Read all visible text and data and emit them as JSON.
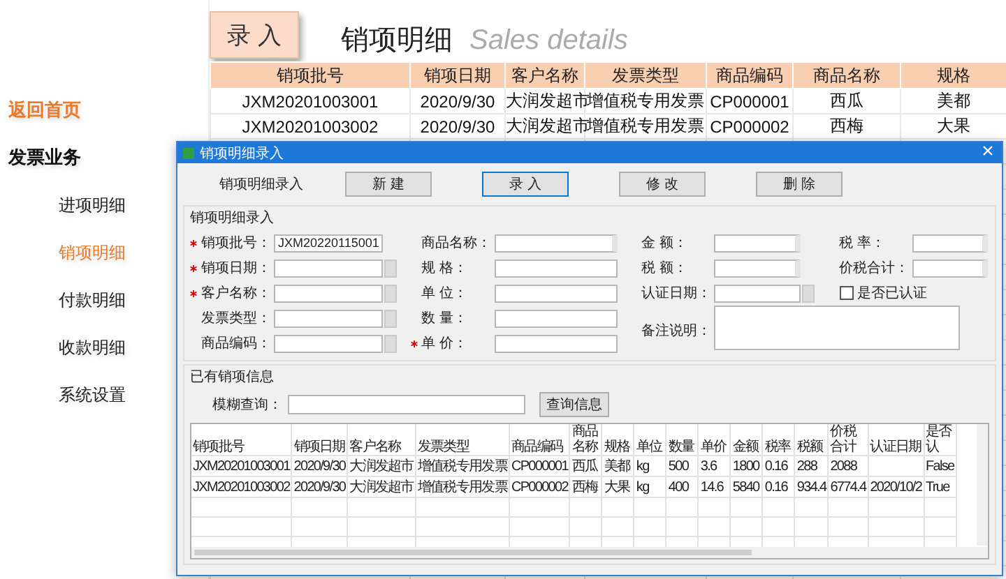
{
  "header_button": {
    "label": "录 入"
  },
  "page_title": "销项明细",
  "page_subtitle": "Sales details",
  "sidebar": {
    "items": [
      {
        "label": "返回首页",
        "kind": "link"
      },
      {
        "label": "发票业务",
        "kind": "heading"
      },
      {
        "label": "进项明细",
        "kind": "item",
        "selected": false
      },
      {
        "label": "销项明细",
        "kind": "item",
        "selected": true
      },
      {
        "label": "付款明细",
        "kind": "item",
        "selected": false
      },
      {
        "label": "收款明细",
        "kind": "item",
        "selected": false
      },
      {
        "label": "系统设置",
        "kind": "item",
        "selected": false
      }
    ]
  },
  "sheet": {
    "columns": [
      "销项批号",
      "销项日期",
      "客户名称",
      "发票类型",
      "商品编码",
      "商品名称",
      "规格"
    ],
    "rows": [
      [
        "JXM20201003001",
        "2020/9/30",
        "大润发超市",
        "增值税专用发票",
        "CP000001",
        "西瓜",
        "美都"
      ],
      [
        "JXM20201003002",
        "2020/9/30",
        "大润发超市",
        "增值税专用发票",
        "CP000002",
        "西梅",
        "大果"
      ]
    ]
  },
  "dialog": {
    "title": "销项明细录入",
    "heading": "销项明细录入",
    "buttons": [
      "新 建",
      "录 入",
      "修 改",
      "删 除"
    ],
    "entry_group": {
      "title": "销项明细录入",
      "columns": [
        [
          {
            "label": "销项批号：",
            "kind": "text",
            "required": true,
            "value": "JXM20220115001"
          },
          {
            "label": "销项日期：",
            "kind": "select",
            "required": true
          },
          {
            "label": "客户名称：",
            "kind": "select",
            "required": true
          },
          {
            "label": "发票类型：",
            "kind": "select",
            "required": false
          },
          {
            "label": "商品编码：",
            "kind": "select",
            "required": false
          }
        ],
        [
          {
            "label": "商品名称：",
            "kind": "spin",
            "required": false
          },
          {
            "label": "规 格：",
            "kind": "text",
            "required": false
          },
          {
            "label": "单 位：",
            "kind": "text",
            "required": false
          },
          {
            "label": "数 量：",
            "kind": "text",
            "required": false
          },
          {
            "label": "单 价：",
            "kind": "text",
            "required": true
          }
        ],
        [
          {
            "label": "金 额：",
            "kind": "spin",
            "required": false
          },
          {
            "label": "税 额：",
            "kind": "spin",
            "required": false
          },
          {
            "label": "认证日期：",
            "kind": "select",
            "required": false
          },
          {
            "label": "备注说明：",
            "kind": "memo",
            "required": false
          }
        ],
        [
          {
            "label": "税 率：",
            "kind": "spin",
            "required": false
          },
          {
            "label": "价税合计：",
            "kind": "spin",
            "required": false
          },
          {
            "label": "是否已认证",
            "kind": "checkbox",
            "checked": false,
            "required": false
          }
        ]
      ]
    },
    "search_group": {
      "title": "已有销项信息",
      "search_label": "模糊查询：",
      "search_button": "查询信息",
      "table": {
        "columns": [
          "销项批号",
          "销项日期",
          "客户名称",
          "发票类型",
          "商品编码",
          "商品名称",
          "规格",
          "单位",
          "数量",
          "单价",
          "金额",
          "税率",
          "税额",
          "价税合计",
          "认证日期",
          "是否认"
        ],
        "rows": [
          [
            "JXM20201003001",
            "2020/9/30",
            "大润发超市",
            "增值税专用发票",
            "CP000001",
            "西瓜",
            "美都",
            "kg",
            "500",
            "3.6",
            "1800",
            "0.16",
            "288",
            "2088",
            "",
            "False"
          ],
          [
            "JXM20201003002",
            "2020/9/30",
            "大润发超市",
            "增值税专用发票",
            "CP000002",
            "西梅",
            "大果",
            "kg",
            "400",
            "14.6",
            "5840",
            "0.16",
            "934.4",
            "6774.4",
            "2020/10/2",
            "True"
          ]
        ]
      }
    }
  }
}
